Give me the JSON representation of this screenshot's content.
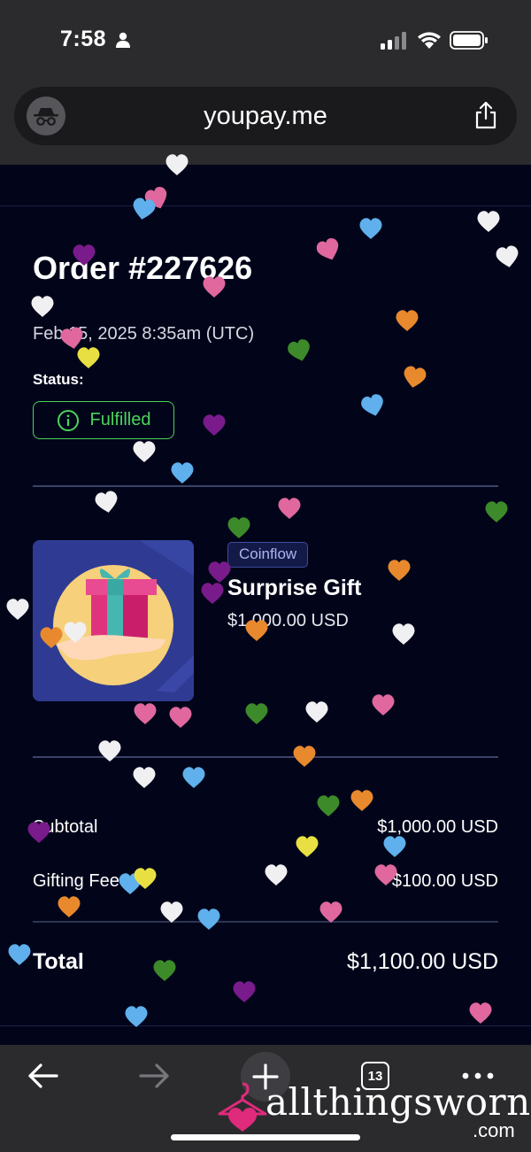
{
  "status_bar": {
    "time": "7:58"
  },
  "browser": {
    "url": "youpay.me"
  },
  "order": {
    "title": "Order #227626",
    "date": "Feb 15, 2025 8:35am (UTC)",
    "status_label": "Status:",
    "status_value": "Fulfilled",
    "status_color": "#4cd35c"
  },
  "item": {
    "tag": "Coinflow",
    "name": "Surprise Gift",
    "price": "$1,000.00 USD"
  },
  "summary": {
    "subtotal_label": "Subtotal",
    "subtotal_value": "$1,000.00 USD",
    "fee_label": "Gifting Fee",
    "fee_value": "$100.00 USD",
    "total_label": "Total",
    "total_value": "$1,100.00 USD"
  },
  "toolbar": {
    "tab_count": "13"
  },
  "watermark": {
    "text": "allthingsworn",
    "suffix": ".com"
  },
  "colors": {
    "background": "#02051a",
    "accent": "#4cd35c",
    "tag": "#aab4f0"
  }
}
